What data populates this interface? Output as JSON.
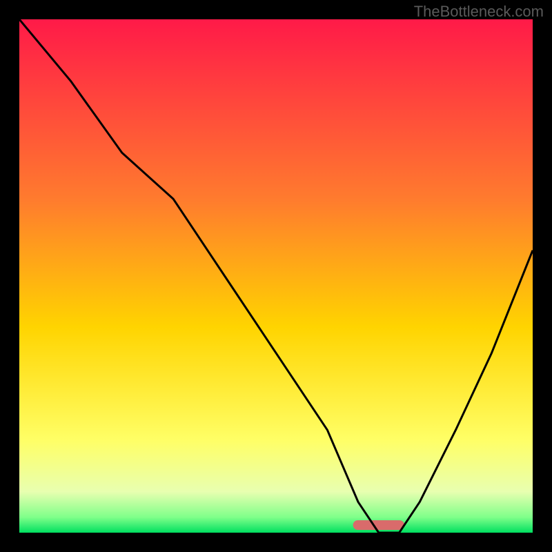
{
  "watermark": "TheBottleneck.com",
  "chart_data": {
    "type": "line",
    "title": "",
    "xlabel": "",
    "ylabel": "",
    "xlim": [
      0,
      100
    ],
    "ylim": [
      0,
      100
    ],
    "gradient_stops": [
      {
        "offset": 0,
        "color": "#ff1a48"
      },
      {
        "offset": 35,
        "color": "#ff7b2e"
      },
      {
        "offset": 60,
        "color": "#ffd400"
      },
      {
        "offset": 82,
        "color": "#ffff66"
      },
      {
        "offset": 92,
        "color": "#e8ffb0"
      },
      {
        "offset": 97,
        "color": "#7fff8a"
      },
      {
        "offset": 100,
        "color": "#00e060"
      }
    ],
    "marker": {
      "x": 70,
      "width": 10,
      "color": "#d96b6b"
    },
    "series": [
      {
        "name": "curve",
        "x": [
          0,
          10,
          20,
          30,
          40,
          50,
          60,
          66,
          70,
          74,
          78,
          85,
          92,
          100
        ],
        "y": [
          100,
          88,
          74,
          65,
          50,
          35,
          20,
          6,
          0,
          0,
          6,
          20,
          35,
          55
        ]
      }
    ]
  }
}
